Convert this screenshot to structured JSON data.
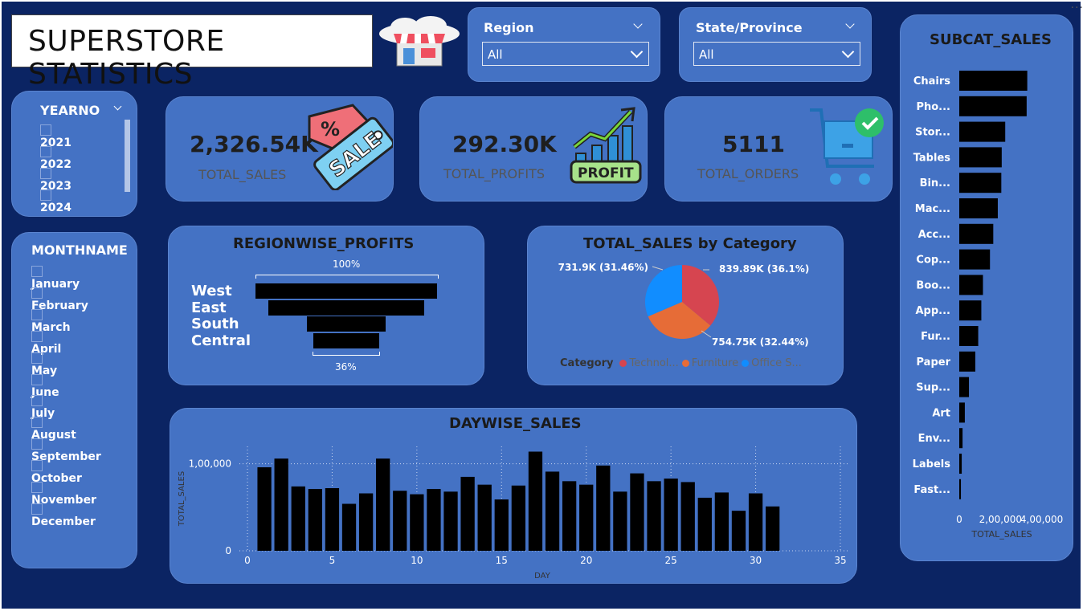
{
  "title": "SUPERSTORE STATISTICS",
  "region": {
    "label": "Region",
    "value": "All"
  },
  "state": {
    "label": "State/Province",
    "value": "All"
  },
  "years": {
    "label": "YEARNO",
    "items": [
      "2021",
      "2022",
      "2023",
      "2024"
    ]
  },
  "months": {
    "label": "MONTHNAME",
    "items": [
      "January",
      "February",
      "March",
      "April",
      "May",
      "June",
      "July",
      "August",
      "September",
      "October",
      "November",
      "December"
    ]
  },
  "kpis": [
    {
      "value": "2,326.54K",
      "label": "TOTAL_SALES",
      "icon": "sale-tag-icon"
    },
    {
      "value": "292.30K",
      "label": "TOTAL_PROFITS",
      "icon": "profit-chart-icon"
    },
    {
      "value": "5111",
      "label": "TOTAL_ORDERS",
      "icon": "shopping-cart-icon"
    }
  ],
  "funnel": {
    "title": "REGIONWISE_PROFITS",
    "top_label": "100%",
    "bottom_label": "36%",
    "regions": [
      "West",
      "East",
      "South",
      "Central"
    ],
    "values": [
      100,
      86,
      43,
      36
    ]
  },
  "pie": {
    "title": "TOTAL_SALES by Category",
    "legend_title": "Category",
    "slices": [
      {
        "name": "Technol...",
        "label": "839.89K (36.1%)",
        "value": 839.89,
        "color": "#d64550"
      },
      {
        "name": "Furniture",
        "label": "754.75K (32.44%)",
        "value": 754.75,
        "color": "#e66c37"
      },
      {
        "name": "Office S...",
        "label": "731.9K (31.46%)",
        "value": 731.9,
        "color": "#118dff"
      }
    ]
  },
  "chart_data": [
    {
      "type": "bar",
      "title": "DAYWISE_SALES",
      "xlabel": "DAY",
      "ylabel": "TOTAL_SALES",
      "x": [
        1,
        2,
        3,
        4,
        5,
        6,
        7,
        8,
        9,
        10,
        11,
        12,
        13,
        14,
        15,
        16,
        17,
        18,
        19,
        20,
        21,
        22,
        23,
        24,
        25,
        26,
        27,
        28,
        29,
        30,
        31
      ],
      "values": [
        96000,
        106000,
        74000,
        71000,
        72000,
        54000,
        66000,
        106000,
        69000,
        65000,
        71000,
        68000,
        85000,
        76000,
        59000,
        75000,
        114000,
        91000,
        80000,
        76000,
        98000,
        68000,
        89000,
        80000,
        83000,
        79000,
        61000,
        67000,
        46000,
        66000,
        51000
      ],
      "xlim": [
        0,
        35
      ],
      "xticks": [
        "0",
        "5",
        "10",
        "15",
        "20",
        "25",
        "30",
        "35"
      ],
      "ylim": [
        0,
        120000
      ],
      "yticks": [
        "0",
        "1,00,000"
      ]
    },
    {
      "type": "bar",
      "orientation": "horizontal",
      "title": "SUBCAT_SALES",
      "xlabel": "TOTAL_SALES",
      "categories": [
        "Chairs",
        "Pho...",
        "Stor...",
        "Tables",
        "Bin...",
        "Mac...",
        "Acc...",
        "Cop...",
        "Boo...",
        "App...",
        "Fur...",
        "Paper",
        "Sup...",
        "Art",
        "Env...",
        "Labels",
        "Fast..."
      ],
      "values": [
        330000,
        327000,
        223000,
        206000,
        204000,
        187000,
        165000,
        149000,
        115000,
        107000,
        92000,
        78000,
        47000,
        27000,
        16000,
        12000,
        8000
      ],
      "xlim": [
        0,
        460000
      ],
      "xticks": [
        "0",
        "2,00,000",
        "4,00,000"
      ]
    }
  ]
}
